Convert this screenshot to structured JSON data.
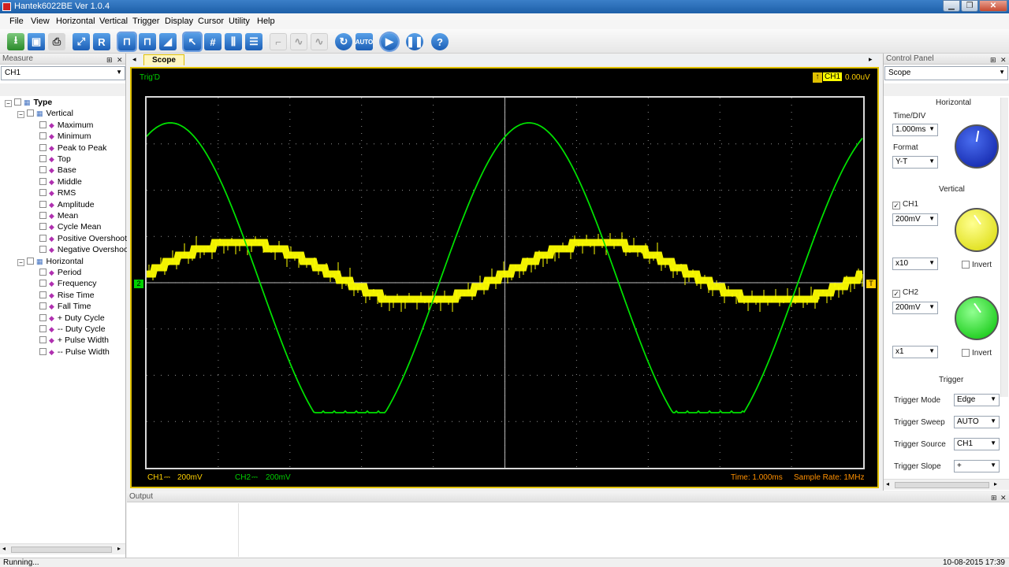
{
  "window": {
    "title": "Hantek6022BE Ver 1.0.4"
  },
  "menu": [
    "File",
    "View",
    "Horizontal",
    "Vertical",
    "Trigger",
    "Display",
    "Cursor",
    "Utility",
    "Help"
  ],
  "toolbar": {
    "reset_label": "R",
    "auto_label": "AUTO"
  },
  "measure_panel": {
    "title": "Measure",
    "channel": "CH1",
    "tree": {
      "root": "Type",
      "vertical_label": "Vertical",
      "vertical_items": [
        "Maximum",
        "Minimum",
        "Peak to Peak",
        "Top",
        "Base",
        "Middle",
        "RMS",
        "Amplitude",
        "Mean",
        "Cycle Mean",
        "Positive Overshoot",
        "Negative Overshoot"
      ],
      "horizontal_label": "Horizontal",
      "horizontal_items": [
        "Period",
        "Frequency",
        "Rise Time",
        "Fall Time",
        "+ Duty Cycle",
        "-- Duty Cycle",
        "+ Pulse Width",
        "-- Pulse Width"
      ]
    }
  },
  "scope": {
    "tab": "Scope",
    "trig_status": "Trig'D",
    "trig_channel": "CH1",
    "trig_level": "0.00uV",
    "ch1_label": "CH1",
    "ch1_scale": "200mV",
    "ch2_label": "CH2",
    "ch2_scale": "200mV",
    "time": "Time: 1.000ms",
    "sample_rate": "Sample Rate: 1MHz",
    "ch2_marker": "2",
    "trig_marker": "T"
  },
  "control_panel": {
    "title": "Control Panel",
    "mode": "Scope",
    "horizontal": {
      "title": "Horizontal",
      "timediv_label": "Time/DIV",
      "timediv": "1.000ms",
      "format_label": "Format",
      "format": "Y-T"
    },
    "vertical": {
      "title": "Vertical",
      "ch1_label": "CH1",
      "ch1_volt": "200mV",
      "ch1_probe": "x10",
      "ch1_invert": "Invert",
      "ch2_label": "CH2",
      "ch2_volt": "200mV",
      "ch2_probe": "x1",
      "ch2_invert": "Invert"
    },
    "trigger": {
      "title": "Trigger",
      "mode_label": "Trigger Mode",
      "mode": "Edge",
      "sweep_label": "Trigger Sweep",
      "sweep": "AUTO",
      "source_label": "Trigger Source",
      "source": "CH1",
      "slope_label": "Trigger Slope",
      "slope": "+"
    }
  },
  "output": {
    "title": "Output"
  },
  "status": {
    "left": "Running...",
    "right": "10-08-2015 17:39"
  },
  "colors": {
    "ch1": "#ffff00",
    "ch2": "#00e000",
    "frame": "#e0c000",
    "grid": "#cfcfcf"
  }
}
